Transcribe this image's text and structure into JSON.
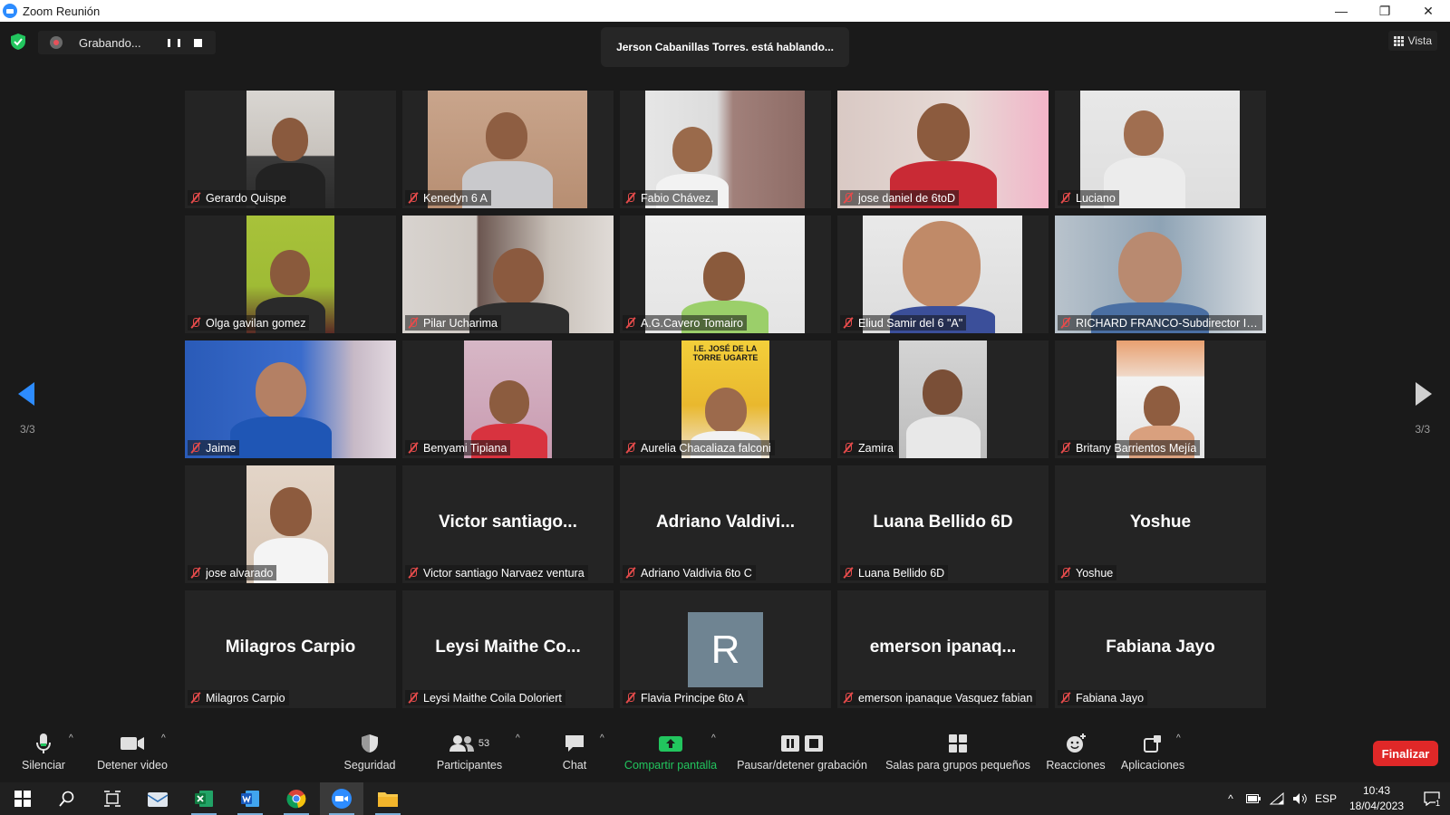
{
  "window": {
    "title": "Zoom Reunión"
  },
  "recording": {
    "status": "Grabando..."
  },
  "speaking_banner": "Jerson Cabanillas Torres. está hablando...",
  "view_button": "Vista",
  "pagination": {
    "left": "3/3",
    "right": "3/3"
  },
  "participants": [
    {
      "name": "Gerardo Quispe",
      "display": "video"
    },
    {
      "name": "Kenedyn 6 A",
      "display": "video"
    },
    {
      "name": "Fabio Chávez.",
      "display": "video"
    },
    {
      "name": "jose daniel de 6toD",
      "display": "video"
    },
    {
      "name": "Luciano",
      "display": "video"
    },
    {
      "name": "Olga gavilan gomez",
      "display": "video"
    },
    {
      "name": "Pilar Ucharima",
      "display": "video"
    },
    {
      "name": "A.G.Cavero Tomairo",
      "display": "video"
    },
    {
      "name": "Eliud Samir del 6 \"A\"",
      "display": "video"
    },
    {
      "name": "RICHARD FRANCO-Subdirector IE ...",
      "display": "video"
    },
    {
      "name": "Jaime",
      "display": "video"
    },
    {
      "name": "Benyami Tipiana",
      "display": "video"
    },
    {
      "name": "Aurelia Chacaliaza falconi",
      "display": "video",
      "poster_text": "I.E. JOSÉ DE LA TORRE UGARTE"
    },
    {
      "name": "Zamira",
      "display": "video"
    },
    {
      "name": "Britany Barrientos Mejía",
      "display": "video"
    },
    {
      "name": "jose alvarado",
      "display": "video"
    },
    {
      "name": "Victor santiago Narvaez ventura",
      "display": "name",
      "big_name": "Victor  santiago..."
    },
    {
      "name": "Adriano Valdivia 6to C",
      "display": "name",
      "big_name": "Adriano  Valdivi..."
    },
    {
      "name": "Luana Bellido 6D",
      "display": "name",
      "big_name": "Luana Bellido 6D"
    },
    {
      "name": "Yoshue",
      "display": "name",
      "big_name": "Yoshue"
    },
    {
      "name": "Milagros Carpio",
      "display": "name",
      "big_name": "Milagros Carpio"
    },
    {
      "name": "Leysi Maithe Coila Doloriert",
      "display": "name",
      "big_name": "Leysi  Maithe  Co..."
    },
    {
      "name": "Flavia Principe  6to A",
      "display": "avatar",
      "initial": "R"
    },
    {
      "name": "emerson ipanaque Vasquez fabian",
      "display": "name",
      "big_name": "emerson  ipanaq..."
    },
    {
      "name": "Fabiana Jayo",
      "display": "name",
      "big_name": "Fabiana Jayo"
    }
  ],
  "toolbar": {
    "mute": "Silenciar",
    "video": "Detener video",
    "security": "Seguridad",
    "participants": "Participantes",
    "participants_count": "53",
    "chat": "Chat",
    "share": "Compartir pantalla",
    "recording": "Pausar/detener grabación",
    "breakout": "Salas para grupos pequeños",
    "reactions": "Reacciones",
    "apps": "Aplicaciones",
    "end": "Finalizar"
  },
  "taskbar": {
    "language": "ESP",
    "time": "10:43",
    "date": "18/04/2023",
    "notifications": "1"
  },
  "colors": {
    "accent": "#2d8cff",
    "share_green": "#22c55e",
    "end_red": "#e02828",
    "mic_off": "#e54b4b"
  }
}
